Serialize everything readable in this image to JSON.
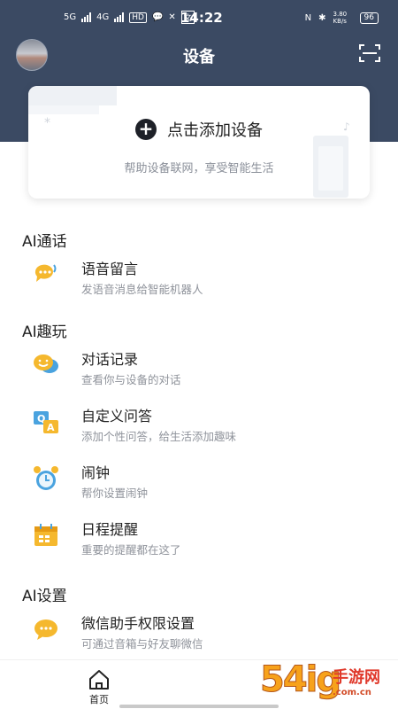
{
  "status_bar": {
    "network_1": "5G",
    "network_2": "4G",
    "hd_badge": "HD",
    "time": "14:22",
    "net_speed": "3.80 KB/s",
    "battery": "96"
  },
  "header": {
    "title": "设备"
  },
  "add_card": {
    "label": "点击添加设备",
    "hint": "帮助设备联网，享受智能生活"
  },
  "sections": [
    {
      "title": "AI通话",
      "items": [
        {
          "title": "语音留言",
          "subtitle": "发语音消息给智能机器人",
          "icon": "voice-message-icon"
        }
      ]
    },
    {
      "title": "AI趣玩",
      "items": [
        {
          "title": "对话记录",
          "subtitle": "查看你与设备的对话",
          "icon": "chat-record-icon"
        },
        {
          "title": "自定义问答",
          "subtitle": "添加个性问答，给生活添加趣味",
          "icon": "qa-icon"
        },
        {
          "title": "闹钟",
          "subtitle": "帮你设置闹钟",
          "icon": "alarm-clock-icon"
        },
        {
          "title": "日程提醒",
          "subtitle": "重要的提醒都在这了",
          "icon": "calendar-icon"
        }
      ]
    },
    {
      "title": "AI设置",
      "items": [
        {
          "title": "微信助手权限设置",
          "subtitle": "可通过音箱与好友聊微信",
          "icon": "wechat-assistant-icon"
        }
      ]
    }
  ],
  "bottom_nav": {
    "home_label": "首页"
  },
  "watermark": {
    "big": "54ig",
    "cn": "手游网",
    "url": ".com.cn"
  },
  "colors": {
    "header_bg": "#3b4a63",
    "icon_yellow": "#f5b82e",
    "icon_blue": "#4aa3df"
  }
}
